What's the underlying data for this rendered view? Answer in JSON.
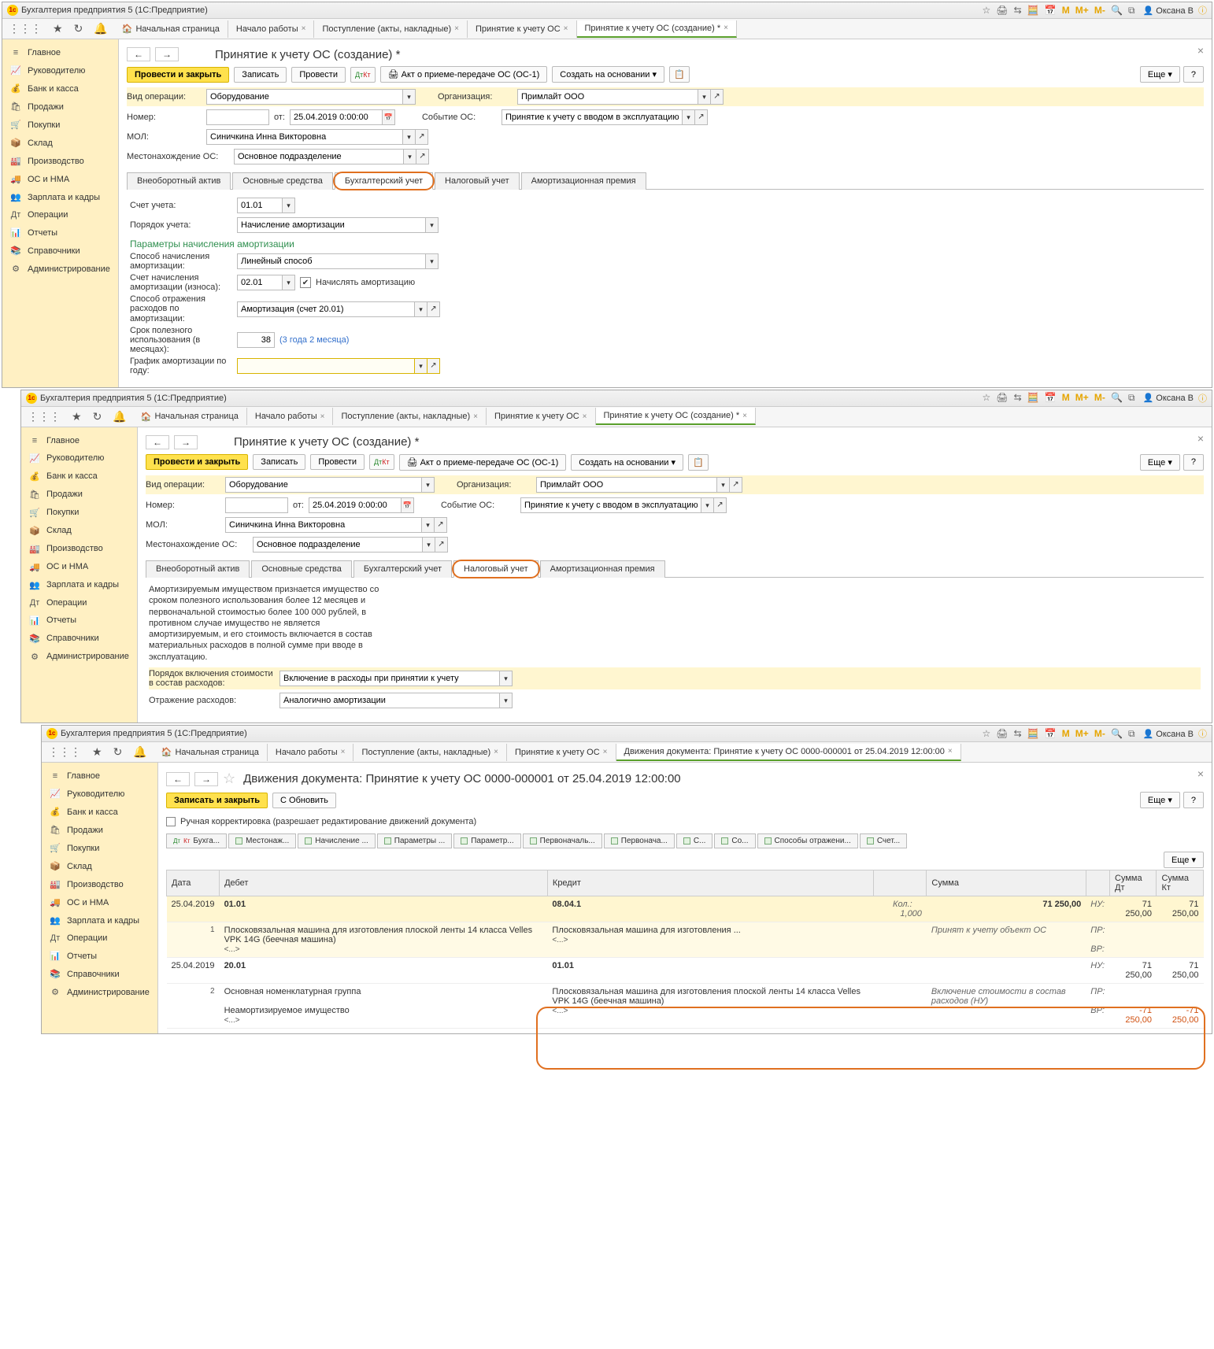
{
  "app_title": "Бухгалтерия предприятия 5  (1С:Предприятие)",
  "user": "Оксана В",
  "sidebar": [
    {
      "icon": "≡",
      "label": "Главное"
    },
    {
      "icon": "📈",
      "label": "Руководителю"
    },
    {
      "icon": "💰",
      "label": "Банк и касса"
    },
    {
      "icon": "🛍",
      "label": "Продажи"
    },
    {
      "icon": "🛒",
      "label": "Покупки"
    },
    {
      "icon": "📦",
      "label": "Склад"
    },
    {
      "icon": "🏭",
      "label": "Производство"
    },
    {
      "icon": "🚚",
      "label": "ОС и НМА"
    },
    {
      "icon": "👥",
      "label": "Зарплата и кадры"
    },
    {
      "icon": "Дт",
      "label": "Операции"
    },
    {
      "icon": "📊",
      "label": "Отчеты"
    },
    {
      "icon": "📚",
      "label": "Справочники"
    },
    {
      "icon": "⚙",
      "label": "Администрирование"
    }
  ],
  "main_tabs": [
    {
      "label": "Начальная страница",
      "closable": false,
      "active": false,
      "home": true
    },
    {
      "label": "Начало работы",
      "closable": true
    },
    {
      "label": "Поступление (акты, накладные)",
      "closable": true
    },
    {
      "label": "Принятие к учету ОС",
      "closable": true
    },
    {
      "label": "Принятие к учету ОС (создание) *",
      "closable": true,
      "active": true
    }
  ],
  "scene1": {
    "page_title": "Принятие к учету ОС (создание) *",
    "buttons": {
      "post_close": "Провести и закрыть",
      "save": "Записать",
      "post": "Провести",
      "act": "Акт о приеме-передаче ОС (ОС-1)",
      "create_based": "Создать на основании",
      "more": "Еще",
      "help": "?"
    },
    "fields": {
      "op_type_lbl": "Вид операции:",
      "op_type_val": "Оборудование",
      "org_lbl": "Организация:",
      "org_val": "Примлайт ООО",
      "number_lbl": "Номер:",
      "number_val": "",
      "from_lbl": "от:",
      "date_val": "25.04.2019 0:00:00",
      "event_lbl": "Событие ОС:",
      "event_val": "Принятие к учету с вводом в эксплуатацию",
      "mol_lbl": "МОЛ:",
      "mol_val": "Синичкина Инна Викторовна",
      "loc_lbl": "Местонахождение ОС:",
      "loc_val": "Основное подразделение"
    },
    "inner_tabs": [
      "Внеоборотный актив",
      "Основные средства",
      "Бухгалтерский учет",
      "Налоговый учет",
      "Амортизационная премия"
    ],
    "active_inner": 2,
    "account_lbl": "Счет учета:",
    "account_val": "01.01",
    "order_lbl": "Порядок учета:",
    "order_val": "Начисление амортизации",
    "group_title": "Параметры начисления амортизации",
    "method_lbl": "Способ начисления амортизации:",
    "method_val": "Линейный способ",
    "dep_acc_lbl": "Счет начисления амортизации (износа):",
    "dep_acc_val": "02.01",
    "dep_chk_lbl": "Начислять амортизацию",
    "exp_lbl": "Способ отражения расходов по амортизации:",
    "exp_val": "Амортизация (счет 20.01)",
    "life_lbl": "Срок полезного использования (в месяцах):",
    "life_val": "38",
    "life_note": "(3 года 2 месяца)",
    "sched_lbl": "График амортизации по году:",
    "sched_val": ""
  },
  "scene2": {
    "active_inner": 3,
    "info": "Амортизируемым имуществом признается имущество со сроком полезного использования более 12 месяцев и первоначальной стоимостью более 100 000 рублей, в противном случае имущество не является амортизируемым, и его стоимость включается в состав материальных расходов в полной сумме при вводе в эксплуатацию.",
    "incl_lbl": "Порядок включения стоимости в состав расходов:",
    "incl_val": "Включение в расходы при принятии к учету",
    "refl_lbl": "Отражение расходов:",
    "refl_val": "Аналогично амортизации"
  },
  "scene3": {
    "tabs": [
      {
        "label": "Начальная страница",
        "home": true
      },
      {
        "label": "Начало работы",
        "closable": true
      },
      {
        "label": "Поступление (акты, накладные)",
        "closable": true
      },
      {
        "label": "Принятие к учету ОС",
        "closable": true
      },
      {
        "label": "Движения документа: Принятие к учету ОС 0000-000001 от 25.04.2019 12:00:00",
        "closable": true,
        "active": true
      }
    ],
    "page_title": "Движения документа: Принятие к учету ОС 0000-000001 от 25.04.2019 12:00:00",
    "save_close": "Записать и закрыть",
    "refresh": "Обновить",
    "more": "Еще",
    "help": "?",
    "manual_lbl": "Ручная корректировка (разрешает редактирование движений документа)",
    "mvtabs": [
      "Бухга...",
      "Местонаж...",
      "Начисление ...",
      "Параметры ...",
      "Параметр...",
      "Первоначаль...",
      "Первонача...",
      "С...",
      "Со...",
      "Способы отражени...",
      "Счет..."
    ],
    "more2": "Еще",
    "headers": [
      "Дата",
      "Дебет",
      "Кредит",
      "",
      "Сумма",
      "",
      "Сумма Дт",
      "Сумма Кт"
    ],
    "rows": [
      {
        "date": "25.04.2019",
        "debit": "01.01",
        "credit": "08.04.1",
        "kol": "Кол.:",
        "qty": "1,000",
        "sum": "71 250,00",
        "tag": "НУ:",
        "sdt": "71 250,00",
        "skt": "71 250,00",
        "n": "1",
        "desc": "Плосковязальная машина для изготовления плоской ленты 14 класса Velles VPK 14G (беечная машина)",
        "credit_desc": "Плосковязальная машина для изготовления ...",
        "dots": "<...>",
        "comment": "Принят к учету объект ОС",
        "pr": "ПР:",
        "vr": "ВР:"
      },
      {
        "date": "25.04.2019",
        "debit": "20.01",
        "credit": "01.01",
        "sum": "",
        "tag": "НУ:",
        "sdt": "71 250,00",
        "skt": "71 250,00",
        "n": "2",
        "desc": "Основная номенклатурная группа",
        "desc2": "Неамортизируемое имущество",
        "dots": "<...>",
        "credit_desc": "Плосковязальная машина для изготовления плоской ленты 14 класса Velles VPK 14G (беечная машина)",
        "comment": "Включение стоимости в состав расходов (НУ)",
        "pr": "ПР:",
        "vr": "ВР:",
        "vr_dt": "-71 250,00",
        "vr_kt": "-71 250,00"
      }
    ]
  }
}
